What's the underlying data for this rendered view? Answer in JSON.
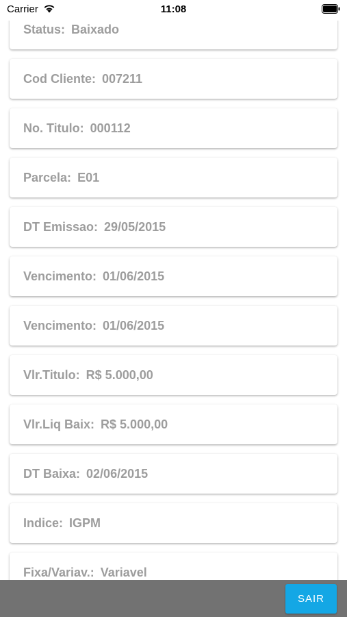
{
  "status_bar": {
    "carrier": "Carrier",
    "time": "11:08"
  },
  "fields": [
    {
      "label": "Status:",
      "value": "Baixado"
    },
    {
      "label": "Cod Cliente:",
      "value": "007211"
    },
    {
      "label": "No. Titulo:",
      "value": "000112"
    },
    {
      "label": "Parcela:",
      "value": "E01"
    },
    {
      "label": "DT Emissao:",
      "value": "29/05/2015"
    },
    {
      "label": "Vencimento:",
      "value": "01/06/2015"
    },
    {
      "label": "Vencimento:",
      "value": "01/06/2015"
    },
    {
      "label": "Vlr.Titulo:",
      "value": "R$ 5.000,00"
    },
    {
      "label": "Vlr.Liq Baix:",
      "value": "R$ 5.000,00"
    },
    {
      "label": "DT Baixa:",
      "value": "02/06/2015"
    },
    {
      "label": "Indice:",
      "value": "IGPM"
    },
    {
      "label": "Fixa/Variav.:",
      "value": "Variavel"
    }
  ],
  "footer": {
    "exit_label": "SAIR"
  },
  "colors": {
    "button": "#14a7e5",
    "footer": "#727272",
    "text": "#9d9d9d"
  }
}
